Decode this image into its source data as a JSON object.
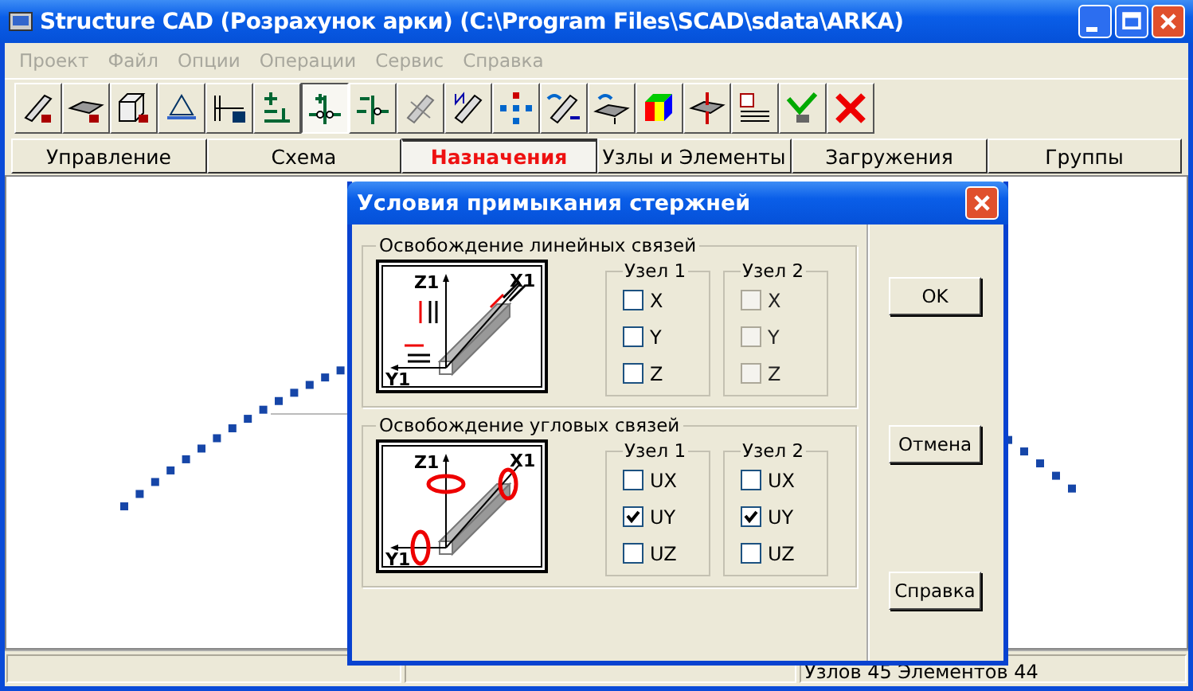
{
  "window": {
    "title": "Structure CAD (Розрахунок арки) (C:\\Program Files\\SCAD\\sdata\\ARKA)"
  },
  "menu": [
    {
      "label": "Проект",
      "disabled": true
    },
    {
      "label": "Файл",
      "disabled": true
    },
    {
      "label": "Опции",
      "disabled": true
    },
    {
      "label": "Операции",
      "disabled": true
    },
    {
      "label": "Сервис",
      "disabled": true
    },
    {
      "label": "Справка",
      "disabled": true
    }
  ],
  "toolbar": [
    {
      "pressed": false
    },
    {
      "pressed": false
    },
    {
      "pressed": false
    },
    {
      "pressed": false
    },
    {
      "pressed": false
    },
    {
      "pressed": false
    },
    {
      "pressed": true
    },
    {
      "pressed": false
    },
    {
      "pressed": false
    },
    {
      "pressed": false
    },
    {
      "pressed": false
    },
    {
      "pressed": false
    },
    {
      "pressed": false
    },
    {
      "pressed": false
    },
    {
      "pressed": false
    },
    {
      "pressed": false
    },
    {
      "pressed": false
    },
    {
      "pressed": false
    }
  ],
  "tabs": [
    {
      "label": "Управление",
      "selected": false
    },
    {
      "label": "Схема",
      "selected": false
    },
    {
      "label": "Назначения",
      "selected": true
    },
    {
      "label": "Узлы и Элементы",
      "selected": false
    },
    {
      "label": "Загружения",
      "selected": false
    },
    {
      "label": "Группы",
      "selected": false
    }
  ],
  "status_bar": {
    "counts": "Узлов 45 Элементов 44"
  },
  "dialog": {
    "title": "Условия примыкания стержней",
    "groups": [
      {
        "title": "Освобождение линейных связей",
        "kind": "linear",
        "diagram": {
          "z": "Z1",
          "x": "X1",
          "y": "Y1"
        },
        "nodes": [
          {
            "title": "Узел 1",
            "options": [
              {
                "label": "X",
                "checked": false,
                "disabled": false
              },
              {
                "label": "Y",
                "checked": false,
                "disabled": false
              },
              {
                "label": "Z",
                "checked": false,
                "disabled": false
              }
            ]
          },
          {
            "title": "Узел 2",
            "options": [
              {
                "label": "X",
                "checked": false,
                "disabled": true
              },
              {
                "label": "Y",
                "checked": false,
                "disabled": true
              },
              {
                "label": "Z",
                "checked": false,
                "disabled": true
              }
            ]
          }
        ]
      },
      {
        "title": "Освобождение угловых связей",
        "kind": "angular",
        "diagram": {
          "z": "Z1",
          "x": "X1",
          "y": "Y1"
        },
        "nodes": [
          {
            "title": "Узел 1",
            "options": [
              {
                "label": "UX",
                "checked": false,
                "disabled": false
              },
              {
                "label": "UY",
                "checked": true,
                "disabled": false
              },
              {
                "label": "UZ",
                "checked": false,
                "disabled": false
              }
            ]
          },
          {
            "title": "Узел 2",
            "options": [
              {
                "label": "UX",
                "checked": false,
                "disabled": false
              },
              {
                "label": "UY",
                "checked": true,
                "disabled": false
              },
              {
                "label": "UZ",
                "checked": false,
                "disabled": false
              }
            ]
          }
        ]
      }
    ],
    "buttons": [
      "OK",
      "Отмена",
      "Справка"
    ]
  }
}
